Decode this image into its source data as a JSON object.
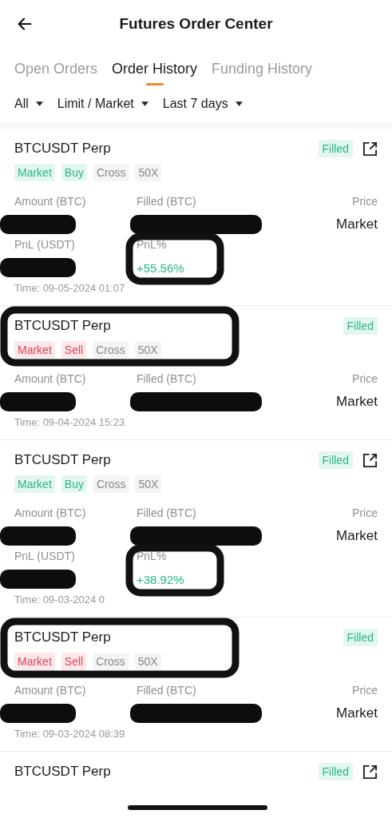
{
  "header": {
    "title": "Futures Order Center"
  },
  "tabs": [
    {
      "label": "Open Orders",
      "selected": false
    },
    {
      "label": "Order History",
      "selected": true
    },
    {
      "label": "Funding History",
      "selected": false
    }
  ],
  "filters": [
    {
      "label": "All"
    },
    {
      "label": "Limit / Market"
    },
    {
      "label": "Last 7 days"
    }
  ],
  "orders": [
    {
      "symbol": "BTCUSDT Perp",
      "status": "Filled",
      "share": true,
      "tags": [
        {
          "label": "Market",
          "kind": "buy"
        },
        {
          "label": "Buy",
          "kind": "buy"
        },
        {
          "label": "Cross",
          "kind": "plain"
        },
        {
          "label": "50X",
          "kind": "plain"
        }
      ],
      "fields": [
        {
          "label": "Amount (BTC)",
          "redacted": true
        },
        {
          "label": "Filled (BTC)",
          "redacted": true
        },
        {
          "label": "PnL (USDT)",
          "redacted": true
        },
        {
          "label": "PnL%",
          "value": "+55.56%"
        }
      ],
      "price_label": "Price",
      "price_value": "Market",
      "time": "Time: 09-05-2024 01:07",
      "pnl_circled": true
    },
    {
      "symbol": "BTCUSDT Perp",
      "status": "Filled",
      "share": false,
      "tags": [
        {
          "label": "Market",
          "kind": "sell"
        },
        {
          "label": "Sell",
          "kind": "sell"
        },
        {
          "label": "Cross",
          "kind": "plain"
        },
        {
          "label": "50X",
          "kind": "plain"
        }
      ],
      "fields": [
        {
          "label": "Amount (BTC)",
          "redacted": true
        },
        {
          "label": "Filled (BTC)",
          "redacted": true
        }
      ],
      "price_label": "Price",
      "price_value": "Market",
      "time": "Time: 09-04-2024 15:23",
      "header_circled": true
    },
    {
      "symbol": "BTCUSDT Perp",
      "status": "Filled",
      "share": true,
      "tags": [
        {
          "label": "Market",
          "kind": "buy"
        },
        {
          "label": "Buy",
          "kind": "buy"
        },
        {
          "label": "Cross",
          "kind": "plain"
        },
        {
          "label": "50X",
          "kind": "plain"
        }
      ],
      "fields": [
        {
          "label": "Amount (BTC)",
          "redacted": true
        },
        {
          "label": "Filled (BTC)",
          "redacted": true
        },
        {
          "label": "PnL (USDT)",
          "redacted": true
        },
        {
          "label": "PnL%",
          "value": "+38.92%"
        }
      ],
      "price_label": "Price",
      "price_value": "Market",
      "time": "Time: 09-03-2024 0",
      "pnl_circled": true
    },
    {
      "symbol": "BTCUSDT Perp",
      "status": "Filled",
      "share": false,
      "tags": [
        {
          "label": "Market",
          "kind": "sell"
        },
        {
          "label": "Sell",
          "kind": "sell"
        },
        {
          "label": "Cross",
          "kind": "plain"
        },
        {
          "label": "50X",
          "kind": "plain"
        }
      ],
      "fields": [
        {
          "label": "Amount (BTC)",
          "redacted": true
        },
        {
          "label": "Filled (BTC)",
          "redacted": true
        }
      ],
      "price_label": "Price",
      "price_value": "Market",
      "time": "Time: 09-03-2024 08:39",
      "header_circled": true
    },
    {
      "symbol": "BTCUSDT Perp",
      "status": "Filled",
      "share": true,
      "partial": true
    }
  ]
}
